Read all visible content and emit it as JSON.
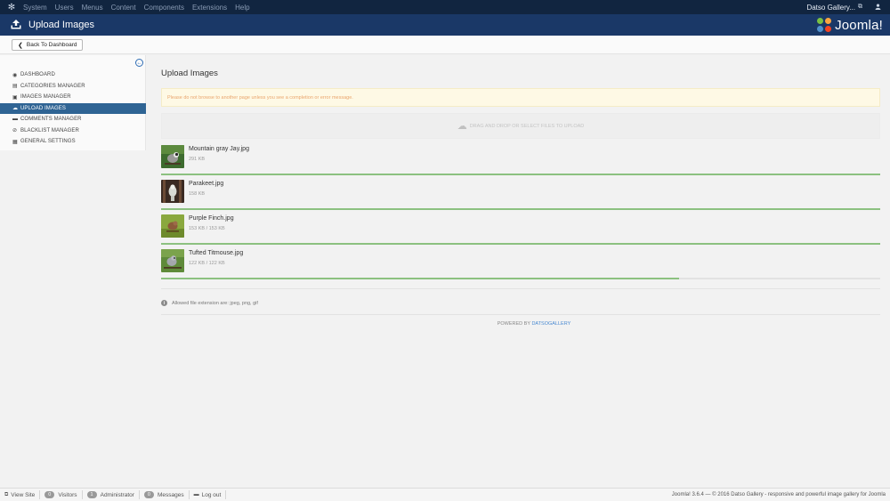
{
  "navbar": {
    "menu": [
      "System",
      "Users",
      "Menus",
      "Content",
      "Components",
      "Extensions",
      "Help"
    ],
    "site_name": "Datso Gallery..."
  },
  "header": {
    "title": "Upload Images",
    "brand": "Joomla!"
  },
  "toolbar": {
    "back_label": "Back To Dashboard"
  },
  "sidebar": {
    "items": [
      {
        "label": "DASHBOARD",
        "icon": "dashboard-icon",
        "active": false
      },
      {
        "label": "CATEGORIES MANAGER",
        "icon": "folder-icon",
        "active": false
      },
      {
        "label": "IMAGES MANAGER",
        "icon": "image-icon",
        "active": false
      },
      {
        "label": "UPLOAD IMAGES",
        "icon": "cloud-upload-icon",
        "active": true
      },
      {
        "label": "COMMENTS MANAGER",
        "icon": "comment-icon",
        "active": false
      },
      {
        "label": "BLACKLIST MANAGER",
        "icon": "ban-icon",
        "active": false
      },
      {
        "label": "GENERAL SETTINGS",
        "icon": "settings-icon",
        "active": false
      }
    ]
  },
  "main": {
    "title": "Upload Images",
    "notice": "Please do not browse to another page unless you see a completion or error message.",
    "dropzone": "DRAG AND DROP OR SELECT FILES TO UPLOAD",
    "files": [
      {
        "name": "Mountain gray Jay.jpg",
        "size": "291 KB",
        "progress": 1.0
      },
      {
        "name": "Parakeet.jpg",
        "size": "158 KB",
        "progress": 1.0
      },
      {
        "name": "Purple Finch.jpg",
        "size": "153 KB / 153 KB",
        "progress": 1.0
      },
      {
        "name": "Tufted Titmouse.jpg",
        "size": "122 KB / 122 KB",
        "progress": 0.72
      }
    ],
    "allowed": "Allowed file extension are: jpeg, png, gif",
    "powered_by": "POWERED BY",
    "powered_link": "DATSOGALLERY"
  },
  "statusbar": {
    "view_site": "View Site",
    "visitors_count": "0",
    "visitors": "Visitors",
    "admin_count": "1",
    "admin": "Administrator",
    "messages_count": "0",
    "messages": "Messages",
    "logout": "Log out",
    "copyright": "Joomla! 3.6.4  —  © 2016 Datso Gallery - responsive and powerful image gallery for Joomla"
  },
  "colors": {
    "navbar": "#112540",
    "header": "#1a3867",
    "sidebar_active": "#2f6494",
    "progress": "#8cc180"
  }
}
